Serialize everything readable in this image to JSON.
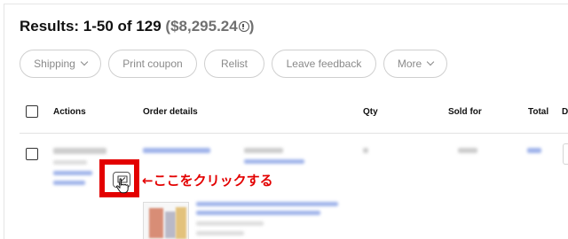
{
  "results": {
    "title": "Results: 1-50 of 129",
    "total": "($8,295.24"
  },
  "filters": [
    {
      "label": "Shipping",
      "has_dropdown": true
    },
    {
      "label": "Print coupon",
      "has_dropdown": false
    },
    {
      "label": "Relist",
      "has_dropdown": false
    },
    {
      "label": "Leave feedback",
      "has_dropdown": false
    },
    {
      "label": "More",
      "has_dropdown": true
    }
  ],
  "table": {
    "columns": [
      "Actions",
      "Order details",
      "Qty",
      "Sold for",
      "Total",
      "D"
    ]
  },
  "annotation": {
    "text": "←ここをクリックする",
    "color": "#e30000"
  },
  "icons": {
    "chat": "chat-bubble-check-icon",
    "info": "info-circle-icon",
    "cursor": "hand-pointer-icon"
  }
}
